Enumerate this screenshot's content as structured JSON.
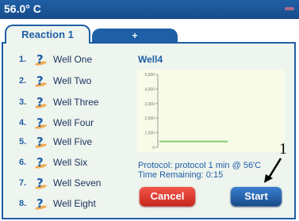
{
  "header": {
    "temperature": "56.0° C"
  },
  "tabs": [
    {
      "label": "Reaction 1"
    },
    {
      "label": "+"
    }
  ],
  "wells": [
    {
      "number": "1.",
      "name": "Well One"
    },
    {
      "number": "2.",
      "name": "Well Two"
    },
    {
      "number": "3.",
      "name": "Well Three"
    },
    {
      "number": "4.",
      "name": "Well Four"
    },
    {
      "number": "5.",
      "name": "Well Five"
    },
    {
      "number": "6.",
      "name": "Well Six"
    },
    {
      "number": "7.",
      "name": "Well Seven"
    },
    {
      "number": "8.",
      "name": "Well Eight"
    }
  ],
  "detail": {
    "well_title": "Well4",
    "protocol": "Protocol: protocol 1 min @ 56'C",
    "time_remaining": "Time Remaining: 0:15"
  },
  "buttons": {
    "cancel": "Cancel",
    "start": "Start"
  },
  "annotation": {
    "callout": "1"
  },
  "chart_data": {
    "type": "line",
    "title": "",
    "xlabel": "",
    "ylabel": "",
    "yticks": [
      "0",
      "1,000",
      "2,000",
      "3,000",
      "4,000",
      "5,000"
    ],
    "ylim": [
      0,
      5000
    ],
    "grid": false,
    "series": [
      {
        "color": "#7ccf6e",
        "x": [
          0,
          1
        ],
        "y": [
          400,
          400
        ]
      }
    ]
  },
  "colors": {
    "accent": "#1f5fa6",
    "cancel": "#d8342a",
    "start": "#1f5fa6",
    "panel": "#eef4ee"
  }
}
